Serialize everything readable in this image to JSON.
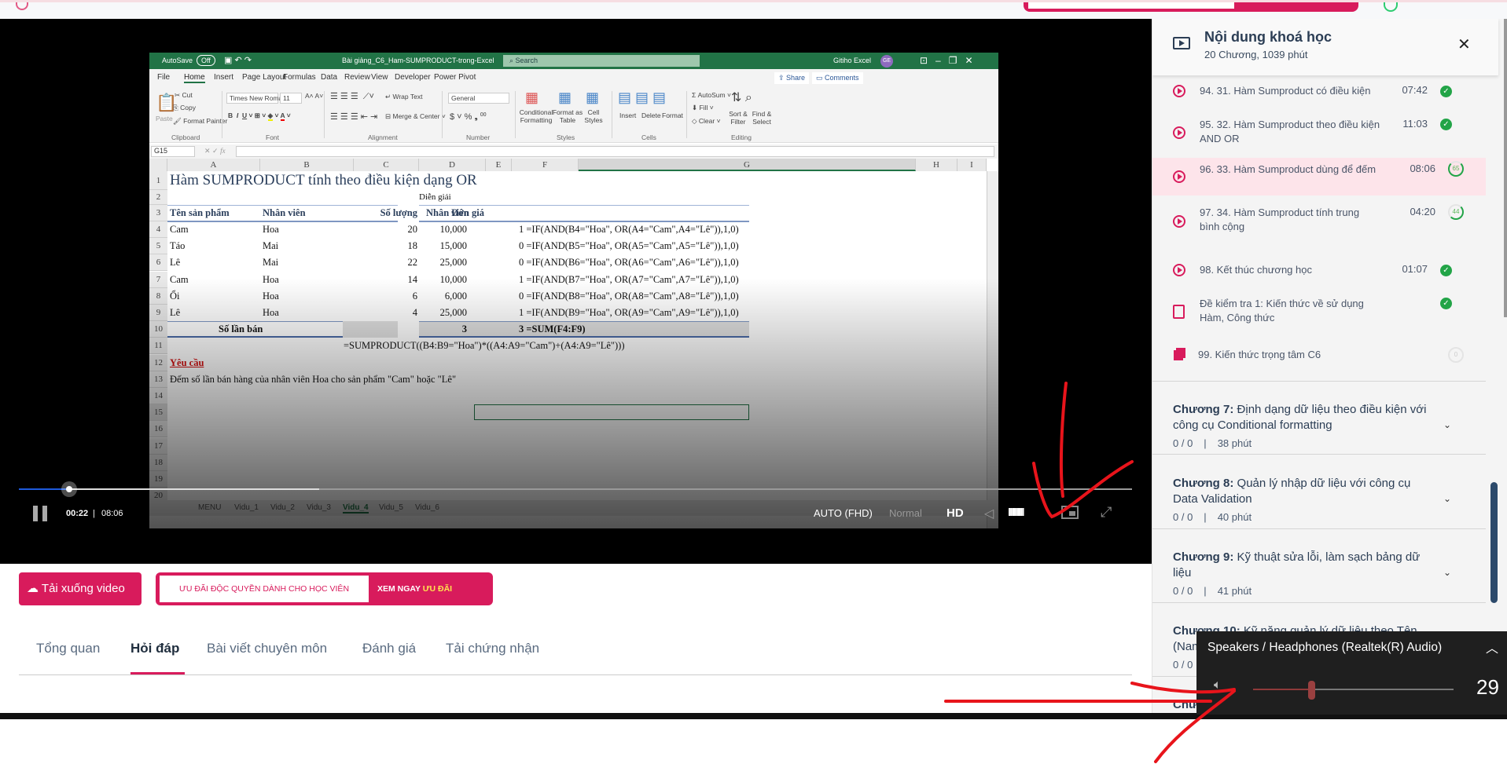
{
  "video": {
    "current_time": "00:22",
    "separator": "|",
    "duration": "08:06",
    "progress_fraction": 0.045,
    "buffered_fraction": 0.27,
    "quality": "AUTO (FHD)",
    "speed": "Normal",
    "hd_label": "HD",
    "volume_bars": "IIIIIIIII",
    "icons": [
      "pause-icon",
      "speaker-icon",
      "pip-icon",
      "fullscreen-icon"
    ]
  },
  "excel": {
    "autosave": "AutoSave",
    "autosave_state": "Off",
    "file_name": "Bài giảng_C6_Ham-SUMPRODUCT-trong-Excel",
    "search": "Search",
    "user": "Gitiho Excel",
    "user_initials": "GE",
    "tabs": [
      "File",
      "Home",
      "Insert",
      "Page Layout",
      "Formulas",
      "Data",
      "Review",
      "View",
      "Developer",
      "Power Pivot"
    ],
    "share": "Share",
    "comments": "Comments",
    "ribbon": {
      "paste": "Paste",
      "cut": "Cut",
      "copy": "Copy",
      "format_painter": "Format Painter",
      "clipboard": "Clipboard",
      "font_name": "Times New Roman",
      "font_size": "11",
      "font": "Font",
      "wrap_text": "Wrap Text",
      "merge_center": "Merge & Center",
      "alignment": "Alignment",
      "number_format": "General",
      "number": "Number",
      "conditional": "Conditional Formatting",
      "format_as_table": "Format as Table",
      "cell_styles": "Cell Styles",
      "styles": "Styles",
      "insert": "Insert",
      "delete": "Delete",
      "format": "Format",
      "cells": "Cells",
      "autosum": "AutoSum",
      "fill": "Fill",
      "clear": "Clear",
      "sort_filter": "Sort & Filter",
      "find_select": "Find & Select",
      "editing": "Editing"
    },
    "name_box": "G15",
    "fx": "fx",
    "columns": [
      "A",
      "B",
      "C",
      "D",
      "E",
      "F",
      "G",
      "H",
      "I"
    ],
    "rows": [
      "1",
      "2",
      "3",
      "4",
      "5",
      "6",
      "7",
      "8",
      "9",
      "10",
      "11",
      "12",
      "13",
      "14",
      "15",
      "16",
      "17",
      "18",
      "19",
      "20"
    ],
    "title": "Hàm SUMPRODUCT tính theo điều kiện dạng OR",
    "dien_giai": "Diễn giải",
    "headers": [
      "Tên sản phẩm",
      "Nhân viên",
      "Số lượng",
      "Đơn giá"
    ],
    "f_header": "Nhân viên",
    "table": [
      [
        "Cam",
        "Hoa",
        "20",
        "10,000",
        "1 =IF(AND(B4=\"Hoa\", OR(A4=\"Cam\",A4=\"Lê\")),1,0)"
      ],
      [
        "Táo",
        "Mai",
        "18",
        "15,000",
        "0 =IF(AND(B5=\"Hoa\", OR(A5=\"Cam\",A5=\"Lê\")),1,0)"
      ],
      [
        "Lê",
        "Mai",
        "22",
        "25,000",
        "0 =IF(AND(B6=\"Hoa\", OR(A6=\"Cam\",A6=\"Lê\")),1,0)"
      ],
      [
        "Cam",
        "Hoa",
        "14",
        "10,000",
        "1 =IF(AND(B7=\"Hoa\", OR(A7=\"Cam\",A7=\"Lê\")),1,0)"
      ],
      [
        "Ổi",
        "Hoa",
        "6",
        "6,000",
        "0 =IF(AND(B8=\"Hoa\", OR(A8=\"Cam\",A8=\"Lê\")),1,0)"
      ],
      [
        "Lê",
        "Hoa",
        "4",
        "25,000",
        "1 =IF(AND(B9=\"Hoa\", OR(A9=\"Cam\",A9=\"Lê\")),1,0)"
      ]
    ],
    "total_label": "Số lần bán",
    "total_value": "3",
    "total_formula": "3 =SUM(F4:F9)",
    "sumproduct": "=SUMPRODUCT((B4:B9=\"Hoa\")*((A4:A9=\"Cam\")+(A4:A9=\"Lê\")))",
    "requirement_label": "Yêu cầu",
    "requirement": "Đếm số lần bán hàng của nhân viên Hoa cho sản phẩm \"Cam\" hoặc \"Lê\"",
    "sheets": [
      "MENU",
      "Vidu_1",
      "Vidu_2",
      "Vidu_3",
      "Vidu_4",
      "Vidu_5",
      "Vidu_6"
    ]
  },
  "actions": {
    "download": "Tải xuống video",
    "promo": "ƯU ĐÃI ĐỘC QUYỀN DÀNH CHO HỌC VIÊN",
    "promo_cta_1": "XEM NGAY",
    "promo_cta_2": "ƯU ĐÃI"
  },
  "tabs": [
    "Tổng quan",
    "Hỏi đáp",
    "Bài viết chuyên môn",
    "Đánh giá",
    "Tải chứng nhận"
  ],
  "active_tab": 1,
  "sidebar": {
    "title": "Nội dung khoá học",
    "subtitle": "20 Chương, 1039 phút",
    "lessons": [
      {
        "title": "94. 31. Hàm Sumproduct có điều kiện",
        "duration": "07:42",
        "status": "done"
      },
      {
        "title": "95. 32. Hàm Sumproduct theo điều kiện AND OR",
        "duration": "11:03",
        "status": "done"
      },
      {
        "title": "96. 33. Hàm Sumproduct dùng để đếm",
        "duration": "08:06",
        "status": "65",
        "active": true
      },
      {
        "title": "97. 34. Hàm Sumproduct tính trung bình cộng",
        "duration": "04:20",
        "status": "44"
      },
      {
        "title": "98. Kết thúc chương học",
        "duration": "01:07",
        "status": "done"
      },
      {
        "title": "Đề kiểm tra 1: Kiến thức về sử dụng Hàm, Công thức",
        "duration": "",
        "status": "done",
        "type": "quiz"
      },
      {
        "title": "99. Kiến thức trọng tâm C6",
        "duration": "",
        "status": "0",
        "type": "doc"
      }
    ],
    "chapters": [
      {
        "label": "Chương 7:",
        "title": "Định dạng dữ liệu theo điều kiện với công cụ Conditional formatting",
        "progress": "0 / 0",
        "sep": "|",
        "minutes": "38 phút"
      },
      {
        "label": "Chương 8:",
        "title": "Quản lý nhập dữ liệu với công cụ Data Validation",
        "progress": "0 / 0",
        "sep": "|",
        "minutes": "40 phút"
      },
      {
        "label": "Chương 9:",
        "title": "Kỹ thuật sửa lỗi, làm sạch bảng dữ liệu",
        "progress": "0 / 0",
        "sep": "|",
        "minutes": "41 phút"
      },
      {
        "label": "Chương 10:",
        "title": "Kỹ năng quản lý dữ liệu theo Tên (Name Range)",
        "progress": "0 / 0",
        "sep": "|",
        "minutes": ""
      },
      {
        "label": "Chư",
        "title": "Exc",
        "progress": "",
        "sep": "",
        "minutes": ""
      }
    ]
  },
  "volume_popup": {
    "device": "Speakers / Headphones (Realtek(R) Audio)",
    "level": "29",
    "level_percent": 29
  },
  "colors": {
    "brand": "#d81b5c",
    "excel_green": "#217346",
    "done_green": "#22a447",
    "annotation": "#e8141b"
  }
}
